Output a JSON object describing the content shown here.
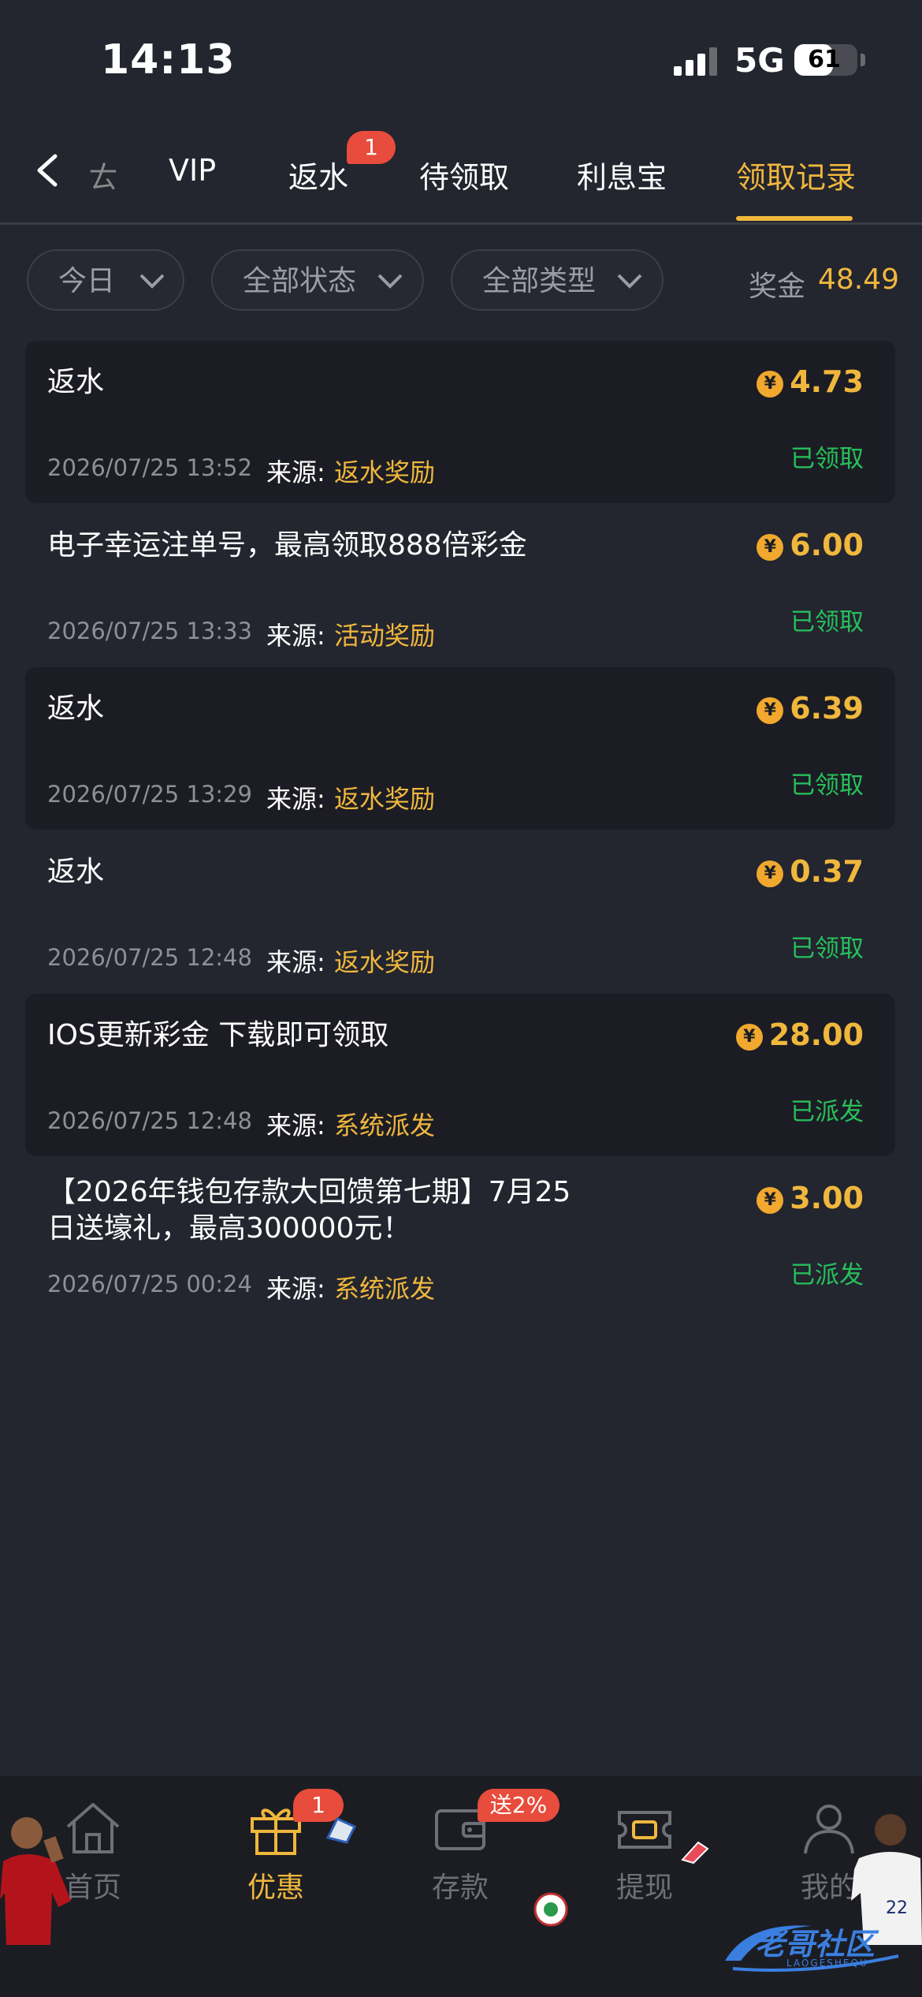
{
  "status_bar": {
    "time": "14:13",
    "network": "5G",
    "battery": "61",
    "battery_level": 0.61
  },
  "tabs": [
    {
      "label": "VIP"
    },
    {
      "label": "返水",
      "badge": "1"
    },
    {
      "label": "待领取"
    },
    {
      "label": "利息宝"
    },
    {
      "label": "领取记录",
      "active": true
    }
  ],
  "filters": {
    "date": "今日",
    "status": "全部状态",
    "type": "全部类型",
    "bonus_label": "奖金",
    "bonus_value": "48.49"
  },
  "records": [
    {
      "title": "返水",
      "amount": "4.73",
      "status": "已领取",
      "date": "2026/07/25 13:52",
      "source_label": "来源:",
      "source": "返水奖励"
    },
    {
      "title": "电子幸运注单号，最高领取888倍彩金",
      "amount": "6.00",
      "status": "已领取",
      "date": "2026/07/25 13:33",
      "source_label": "来源:",
      "source": "活动奖励"
    },
    {
      "title": "返水",
      "amount": "6.39",
      "status": "已领取",
      "date": "2026/07/25 13:29",
      "source_label": "来源:",
      "source": "返水奖励"
    },
    {
      "title": "返水",
      "amount": "0.37",
      "status": "已领取",
      "date": "2026/07/25 12:48",
      "source_label": "来源:",
      "source": "返水奖励"
    },
    {
      "title": "IOS更新彩金  下载即可领取",
      "amount": "28.00",
      "status": "已派发",
      "date": "2026/07/25 12:48",
      "source_label": "来源:",
      "source": "系统派发"
    },
    {
      "title_line1": "【2026年钱包存款大回馈第七期】7月25",
      "title_line2": "日送壕礼，最高300000元！",
      "amount": "3.00",
      "status": "已派发",
      "date": "2026/07/25 00:24",
      "source_label": "来源:",
      "source": "系统派发"
    }
  ],
  "coin_symbol": "¥",
  "bottom_nav": [
    {
      "label": "首页",
      "icon": "home-icon"
    },
    {
      "label": "优惠",
      "icon": "gift-icon",
      "active": true,
      "badge": "1"
    },
    {
      "label": "存款",
      "icon": "wallet-icon",
      "badge": "送2%"
    },
    {
      "label": "提现",
      "icon": "withdraw-icon"
    },
    {
      "label": "我的",
      "icon": "user-icon"
    }
  ],
  "watermark": {
    "text": "老哥社区",
    "sub": "LAOGESHEQU"
  },
  "colors": {
    "accent": "#f0b73d",
    "success": "#26c05b",
    "badge": "#e74c3c",
    "background": "#23252f"
  }
}
